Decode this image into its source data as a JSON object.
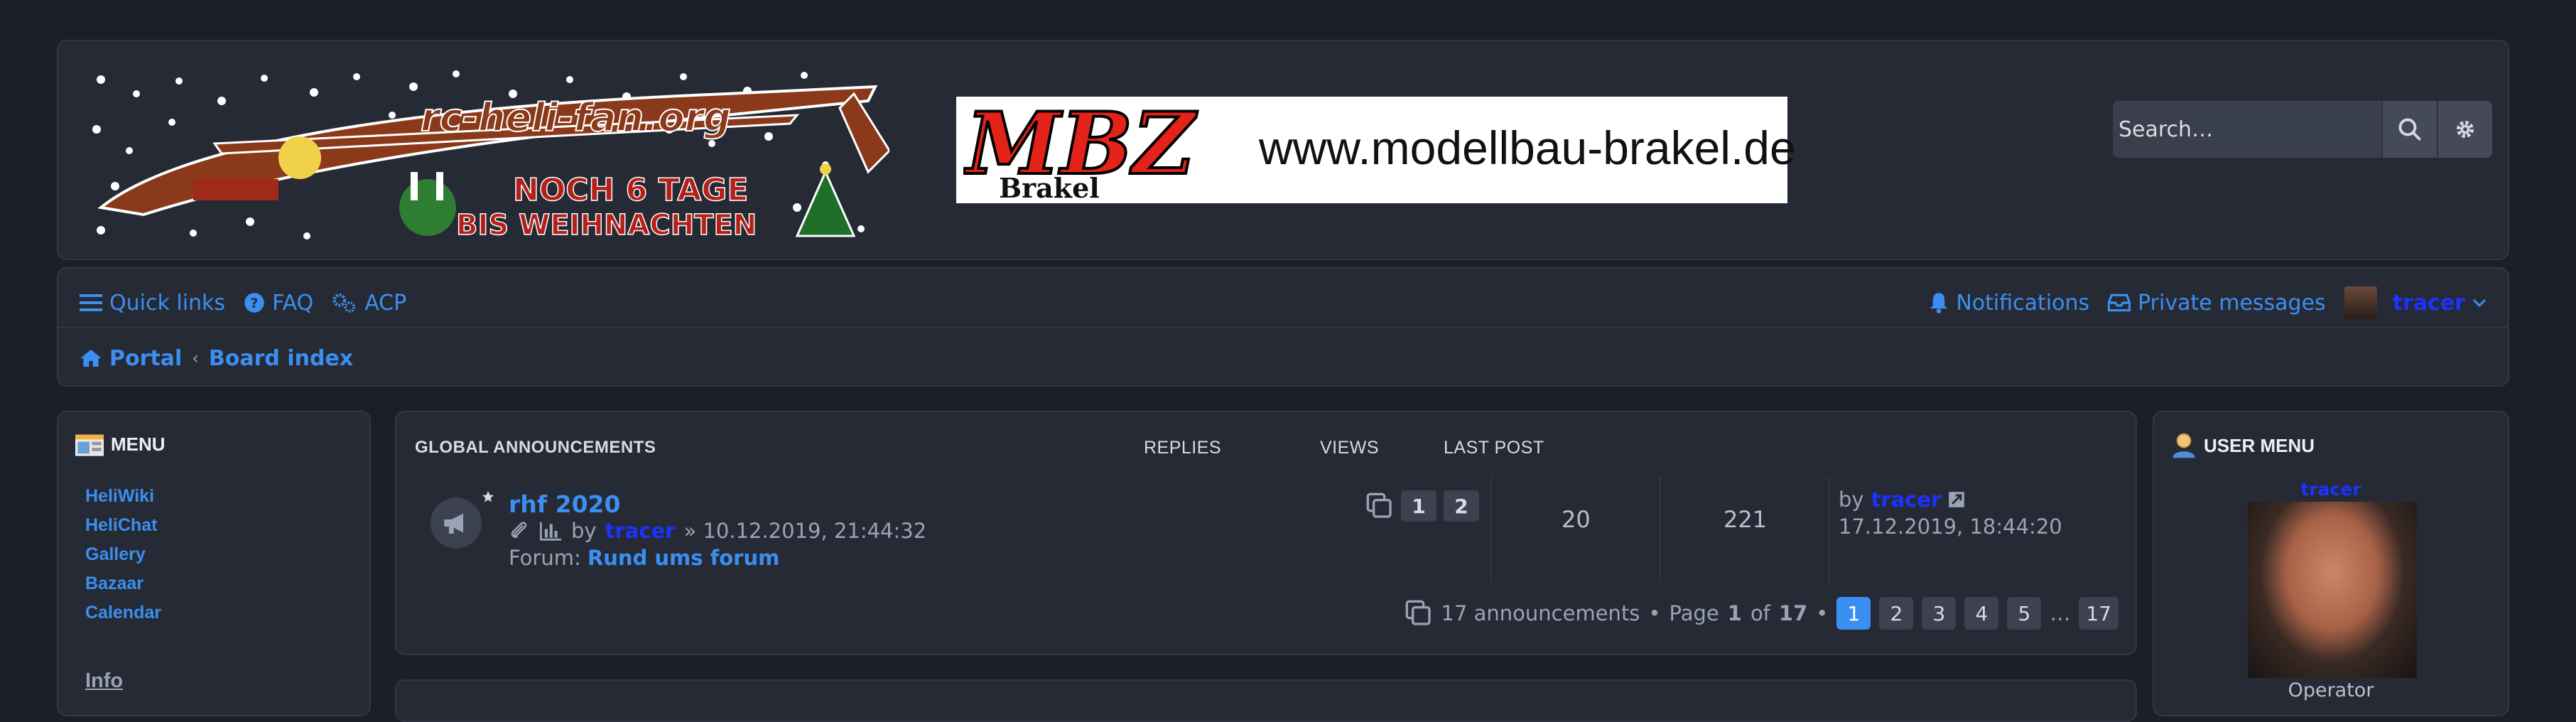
{
  "header": {
    "logo_text": "rc-heli-fan.org",
    "logo_countdown_1": "NOCH 6 TAGE",
    "logo_countdown_2": "BIS WEIHNACHTEN",
    "banner_brand": "MBZ",
    "banner_brand_sub": "Brakel",
    "banner_url": "www.modellbau-brakel.de",
    "search_placeholder": "Search…",
    "search_icon": "search-icon",
    "advanced_icon": "gear-icon"
  },
  "nav": {
    "quick_links": "Quick links",
    "faq": "FAQ",
    "acp": "ACP",
    "notifications": "Notifications",
    "private_messages": "Private messages",
    "username": "tracer",
    "breadcrumb": {
      "portal": "Portal",
      "board_index": "Board index"
    }
  },
  "left_menu": {
    "title": "MENU",
    "items": [
      "HeliWiki",
      "HeliChat",
      "Gallery",
      "Bazaar",
      "Calendar"
    ],
    "info": "Info"
  },
  "announcements": {
    "title": "GLOBAL ANNOUNCEMENTS",
    "col_replies": "REPLIES",
    "col_views": "VIEWS",
    "col_last_post": "LAST POST",
    "topic": {
      "title": "rhf 2020",
      "by": "by",
      "author": "tracer",
      "date": "» 10.12.2019, 21:44:32",
      "forum_label": "Forum:",
      "forum": "Rund ums forum",
      "pages": [
        "1",
        "2"
      ],
      "replies": "20",
      "views": "221",
      "last_by": "by",
      "last_author": "tracer",
      "last_date": "17.12.2019, 18:44:20"
    },
    "pagination": {
      "summary": "17 announcements",
      "bullet": "•",
      "page_word": "Page",
      "current": "1",
      "of_word": "of",
      "total": "17",
      "pages": [
        "1",
        "2",
        "3",
        "4",
        "5"
      ],
      "ellipsis": "…",
      "last": "17"
    }
  },
  "user_menu": {
    "title": "USER MENU",
    "username": "tracer",
    "rank": "Operator"
  },
  "colors": {
    "background": "#1c1f28",
    "panel": "#262a35",
    "link": "#3b8ff0",
    "username": "#1a33ff",
    "active_page": "#3b8ff0"
  }
}
